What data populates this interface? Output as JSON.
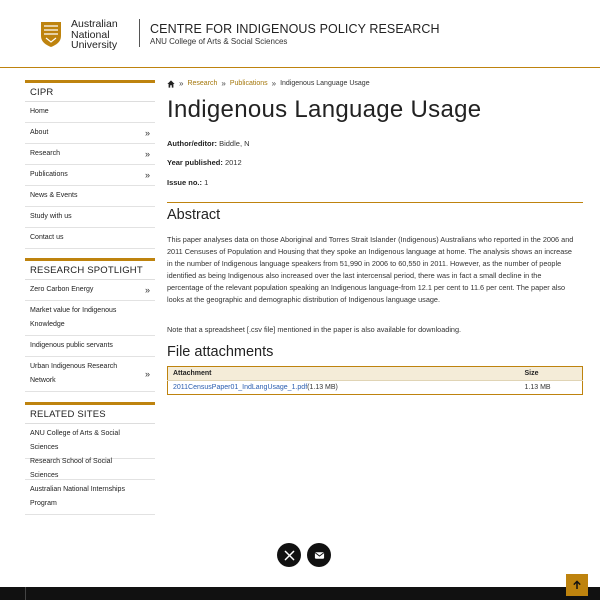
{
  "header": {
    "university_name_line1": "Australian",
    "university_name_line2": "National",
    "university_name_line3": "University",
    "site_title": "CENTRE FOR INDIGENOUS POLICY RESEARCH",
    "site_subtitle": "ANU College of Arts & Social Sciences"
  },
  "sidebar": {
    "section1_heading": "CIPR",
    "section1_items": [
      {
        "label": "Home",
        "has_children": false
      },
      {
        "label": "About",
        "has_children": true
      },
      {
        "label": "Research",
        "has_children": true
      },
      {
        "label": "Publications",
        "has_children": true
      },
      {
        "label": "News & Events",
        "has_children": false
      },
      {
        "label": "Study with us",
        "has_children": false
      },
      {
        "label": "Contact us",
        "has_children": false
      }
    ],
    "section2_heading": "RESEARCH SPOTLIGHT",
    "section2_items": [
      {
        "label": "Zero Carbon Energy",
        "has_children": true
      },
      {
        "label": "Market value for Indigenous Knowledge",
        "has_children": false
      },
      {
        "label": "Indigenous public servants",
        "has_children": false
      },
      {
        "label": "Urban Indigenous Research Network",
        "has_children": true
      }
    ],
    "section3_heading": "RELATED SITES",
    "section3_items": [
      {
        "label": "ANU College of Arts & Social Sciences"
      },
      {
        "label": "Research School of Social Sciences"
      },
      {
        "label": "Australian National Internships Program"
      }
    ],
    "chevron": "»"
  },
  "breadcrumb": {
    "sep": "»",
    "items": [
      "Research",
      "Publications",
      "Indigenous Language Usage"
    ]
  },
  "page": {
    "title": "Indigenous Language Usage",
    "author_label": "Author/editor:",
    "author_value": "Biddle, N",
    "year_label": "Year published:",
    "year_value": "2012",
    "issue_label": "Issue no.:",
    "issue_value": "1",
    "abstract_heading": "Abstract",
    "abstract_text": "This paper analyses data on those Aboriginal and Torres Strait Islander (Indigenous) Australians who reported in the 2006 and 2011 Censuses of Population and Housing that they spoke an Indigenous language at home. The analysis shows an increase in the number of Indigenous language speakers from 51,990 in 2006 to 60,550 in 2011. However, as the number of people identified as being Indigenous also increased over the last intercensal period, there was in fact a small decline in the percentage of the relevant population speaking an Indigenous language-from 12.1 per cent to 11.6 per cent. The paper also looks at the geographic and demographic distribution of Indigenous language usage.",
    "note_text": "Note that a spreadsheet [.csv file] mentioned in the paper is also available for downloading.",
    "attachments_heading": "File attachments"
  },
  "attachments": {
    "col_attachment": "Attachment",
    "col_size": "Size",
    "rows": [
      {
        "file": "2011CensusPaper01_IndLangUsage_1.pdf",
        "inline_size": "(1.13 MB)",
        "size": "1.13 MB"
      }
    ]
  },
  "colors": {
    "accent": "#be830e",
    "link": "#2a5db0"
  },
  "icons": {
    "social1": "x-twitter-icon",
    "social2": "email-icon",
    "back_to_top": "arrow-up-icon"
  }
}
